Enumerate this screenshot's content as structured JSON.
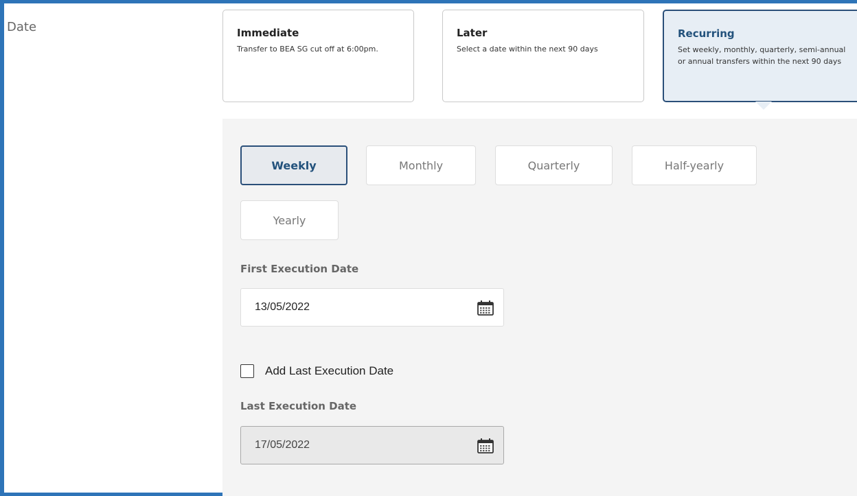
{
  "section": {
    "label": "Date"
  },
  "date_options": [
    {
      "title": "Immediate",
      "description": "Transfer to BEA SG cut off at 6:00pm."
    },
    {
      "title": "Later",
      "description": "Select a date within the next 90 days"
    },
    {
      "title": "Recurring",
      "description": "Set weekly, monthly, quarterly, semi-annual or annual transfers within the next 90 days",
      "selected": true
    }
  ],
  "frequency": {
    "options": [
      "Weekly",
      "Monthly",
      "Quarterly",
      "Half-yearly",
      "Yearly"
    ],
    "selected": "Weekly"
  },
  "first_execution": {
    "label": "First Execution Date",
    "value": "13/05/2022",
    "icon": "calendar-icon"
  },
  "add_last_execution": {
    "label": "Add Last Execution Date",
    "checked": false
  },
  "last_execution": {
    "label": "Last Execution Date",
    "value": "17/05/2022",
    "icon": "calendar-icon",
    "disabled": true
  },
  "colors": {
    "accent": "#2a4f79",
    "selected_bg": "#e7eef5",
    "frame": "#2e74b8"
  }
}
